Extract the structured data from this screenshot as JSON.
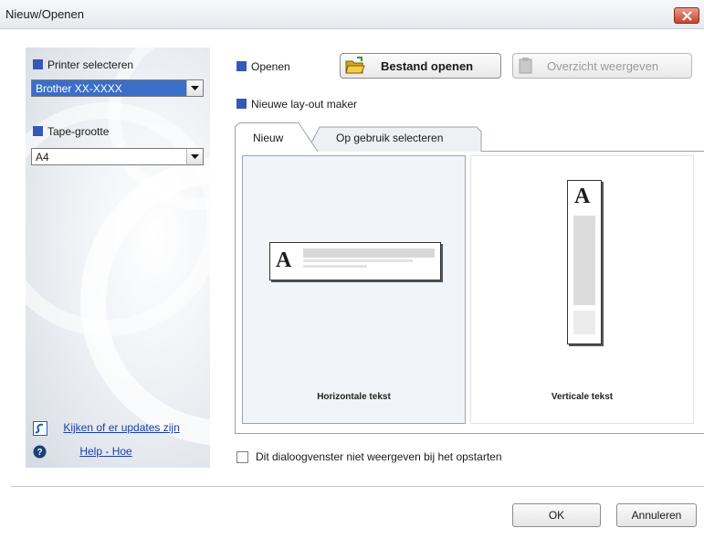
{
  "window": {
    "title": "Nieuw/Openen"
  },
  "left": {
    "printer_label": "Printer selecteren",
    "printer_value": "Brother XX-XXXX",
    "tape_label": "Tape-grootte",
    "tape_value": "A4",
    "update_link": "Kijken of er updates zijn",
    "help_link": "Help - Hoe"
  },
  "open_section": {
    "label": "Openen",
    "open_file_button": "Bestand openen",
    "overview_button": "Overzicht weergeven"
  },
  "new_layout": {
    "label": "Nieuwe lay-out maker",
    "tabs": [
      {
        "label": "Nieuw"
      },
      {
        "label": "Op gebruik selecteren"
      }
    ],
    "options": [
      {
        "caption": "Horizontale tekst",
        "glyph": "A"
      },
      {
        "caption": "Verticale tekst",
        "glyph": "A"
      }
    ]
  },
  "startup_checkbox": {
    "label": "Dit dialoogvenster niet weergeven bij het opstarten",
    "checked": false
  },
  "dialog_buttons": {
    "ok": "OK",
    "cancel": "Annuleren"
  },
  "colors": {
    "accent_square": "#3558b8",
    "selection": "#3b6ec6",
    "link": "#1c3fa8",
    "close": "#c4452f"
  },
  "icons": [
    "close-icon",
    "folder-open-icon",
    "overview-icon",
    "update-icon",
    "help-icon",
    "chevron-down-icon"
  ]
}
